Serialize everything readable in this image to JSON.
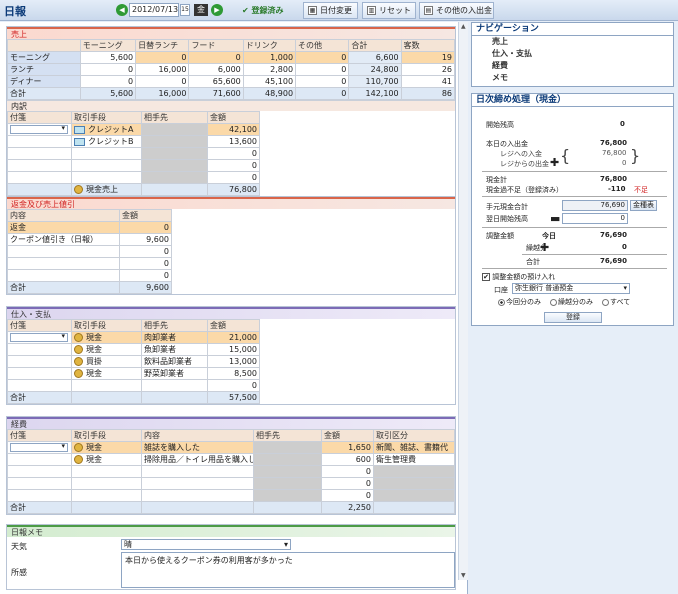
{
  "app": {
    "title": "日報"
  },
  "toolbar": {
    "date": "2012/07/13",
    "day": "金",
    "reg_status": "登録済み",
    "date_change": "日付変更",
    "reset": "リセット",
    "other_deposit": "その他の入出金",
    "cal_label": "15"
  },
  "sales": {
    "header": "売上",
    "columns": [
      "",
      "モーニング",
      "日替ランチ",
      "フード",
      "ドリンク",
      "その他",
      "合計",
      "客数"
    ],
    "rows": [
      [
        "モーニング",
        "5,600",
        "0",
        "0",
        "1,000",
        "0",
        "6,600",
        "19"
      ],
      [
        "ランチ",
        "0",
        "16,000",
        "6,000",
        "2,800",
        "0",
        "24,800",
        "26"
      ],
      [
        "ディナー",
        "0",
        "0",
        "65,600",
        "45,100",
        "0",
        "110,700",
        "41"
      ],
      [
        "合計",
        "5,600",
        "16,000",
        "71,600",
        "48,900",
        "0",
        "142,100",
        "86"
      ]
    ]
  },
  "breakdown": {
    "header": "内訳",
    "columns": [
      "付箋",
      "取引手段",
      "相手先",
      "金額"
    ],
    "rows": [
      [
        "",
        "クレジットA",
        "",
        "42,100"
      ],
      [
        "",
        "クレジットB",
        "",
        "13,600"
      ],
      [
        "",
        "",
        "",
        "0"
      ],
      [
        "",
        "",
        "",
        "0"
      ],
      [
        "",
        "",
        "",
        "0"
      ],
      [
        "",
        "現金売上",
        "",
        "76,800"
      ]
    ]
  },
  "refund": {
    "header": "返金及び売上値引",
    "columns": [
      "内容",
      "金額"
    ],
    "rows": [
      [
        "返金",
        "0"
      ],
      [
        "クーポン値引き（日報）",
        "9,600"
      ],
      [
        "",
        "0"
      ],
      [
        "",
        "0"
      ],
      [
        "",
        "0"
      ]
    ],
    "total_label": "合計",
    "total": "9,600"
  },
  "purchase": {
    "header": "仕入・支払",
    "columns": [
      "付箋",
      "取引手段",
      "相手先",
      "金額"
    ],
    "rows": [
      [
        "",
        "現金",
        "肉卸業者",
        "21,000"
      ],
      [
        "",
        "現金",
        "魚卸業者",
        "15,000"
      ],
      [
        "",
        "買掛",
        "飲料品卸業者",
        "13,000"
      ],
      [
        "",
        "現金",
        "野菜卸業者",
        "8,500"
      ],
      [
        "",
        "",
        "",
        "0"
      ]
    ],
    "total_label": "合計",
    "total": "57,500"
  },
  "expenses": {
    "header": "経費",
    "columns": [
      "付箋",
      "取引手段",
      "内容",
      "相手先",
      "金額",
      "取引区分"
    ],
    "rows": [
      [
        "",
        "現金",
        "雑誌を購入した",
        "",
        "1,650",
        "新聞、雑誌、書籍代"
      ],
      [
        "",
        "現金",
        "掃除用品／トイレ用品を購入した",
        "",
        "600",
        "衛生管理費"
      ],
      [
        "",
        "",
        "",
        "",
        "0",
        ""
      ],
      [
        "",
        "",
        "",
        "",
        "0",
        ""
      ],
      [
        "",
        "",
        "",
        "",
        "0",
        ""
      ]
    ],
    "total_label": "合計",
    "total": "2,250"
  },
  "memo": {
    "header": "日報メモ",
    "weather_label": "天気",
    "weather": "晴",
    "notes_label": "所感",
    "notes": "本日から使えるクーポン券の利用客が多かった"
  },
  "navigation": {
    "title": "ナビゲーション",
    "items": [
      "売上",
      "仕入・支払",
      "経費",
      "メモ"
    ]
  },
  "closing": {
    "title": "日次締め処理（現金）",
    "opening_label": "開始残高",
    "opening": "0",
    "deposit_label": "本日の入出金",
    "deposit": "76,800",
    "to_register_label": "レジへの入金",
    "to_register": "76,800",
    "from_register_label": "レジからの出金",
    "from_register": "0",
    "cash_total_label": "現金計",
    "cash_total": "76,800",
    "shortage_label": "現金過不足（登録済み）",
    "shortage": "-110",
    "shortage_note": "不足",
    "onhand_label": "手元現金合計",
    "onhand": "76,690",
    "denom_btn": "金種表",
    "next_label": "翌日開始残高",
    "next": "0",
    "adjust_label": "調整金額",
    "today_label": "今日",
    "today": "76,690",
    "carry_label": "繰越分",
    "carry": "0",
    "sum_label": "合計",
    "sum": "76,690",
    "deposit_adjust_label": "調整金額の預け入れ",
    "account_label": "口座",
    "account": "弥生銀行 普通預金",
    "radio_options": [
      "今回分のみ",
      "繰越分のみ",
      "すべて"
    ],
    "register_btn": "登録"
  }
}
